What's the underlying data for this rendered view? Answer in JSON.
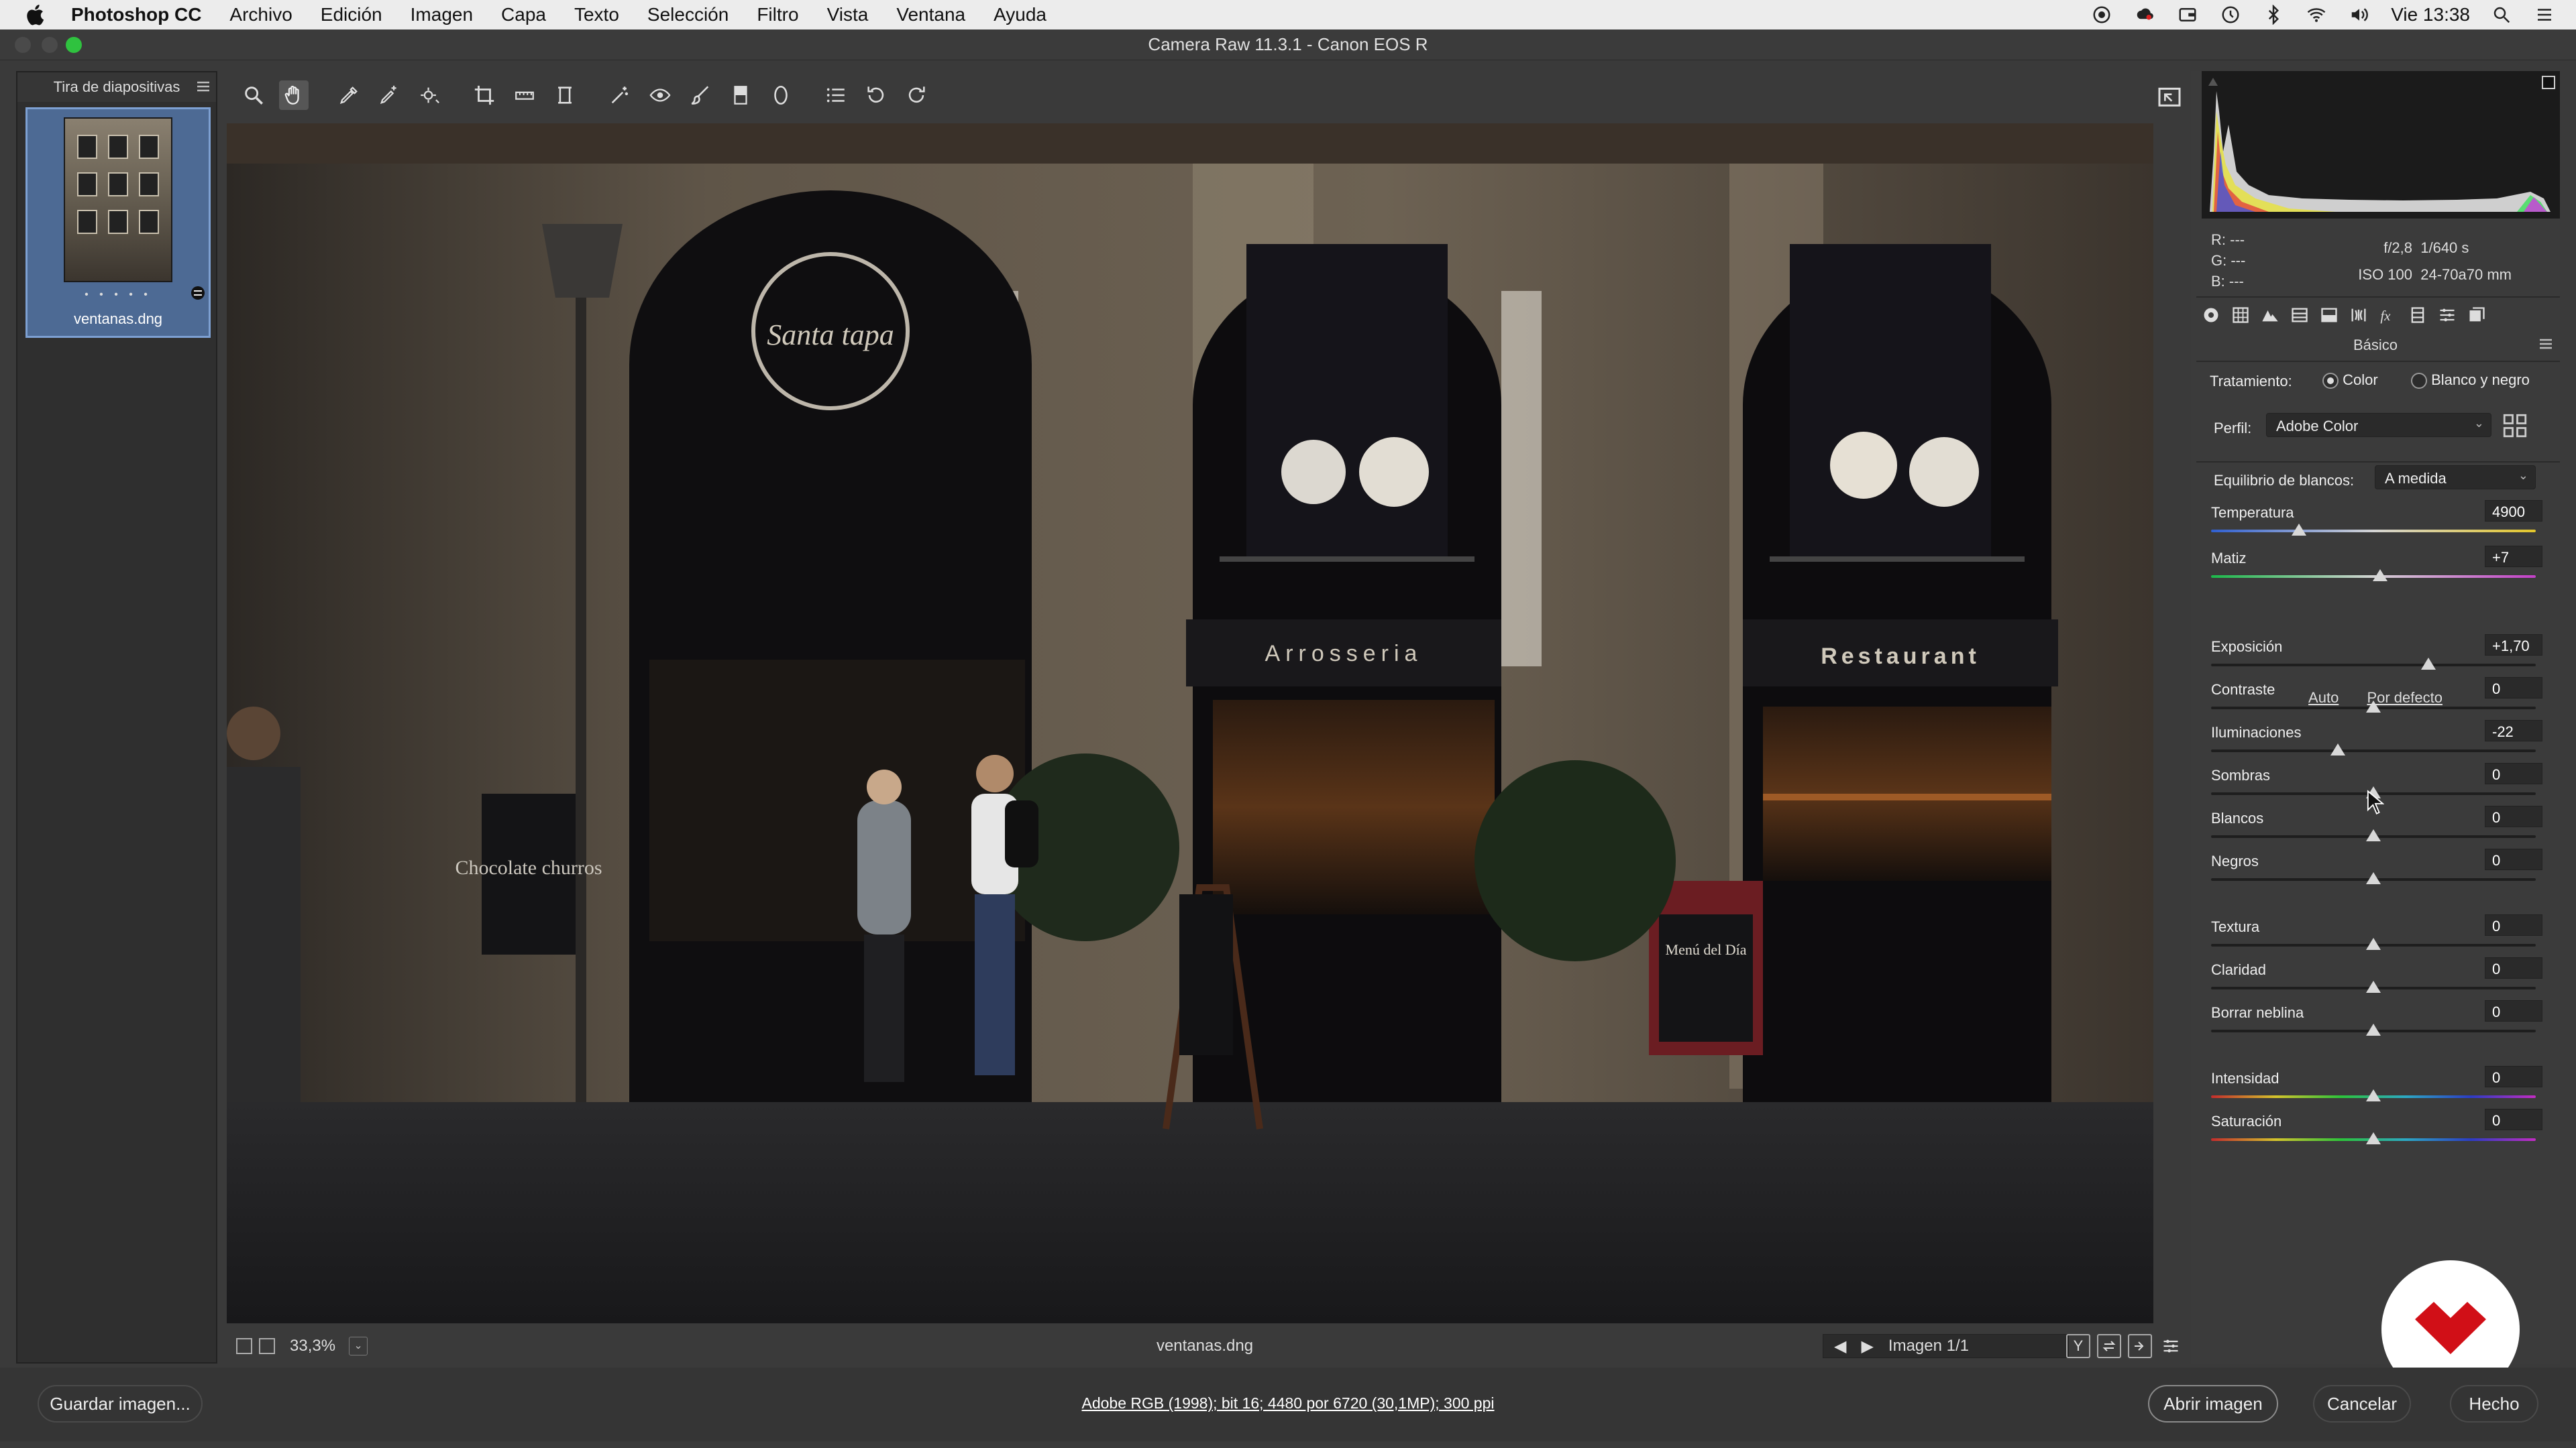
{
  "menubar": {
    "items": [
      "Photoshop CC",
      "Archivo",
      "Edición",
      "Imagen",
      "Capa",
      "Texto",
      "Selección",
      "Filtro",
      "Vista",
      "Ventana",
      "Ayuda"
    ],
    "clock": "Vie 13:38"
  },
  "window": {
    "title": "Camera Raw 11.3.1 -  Canon EOS R"
  },
  "filmstrip": {
    "title": "Tira de diapositivas",
    "dots": "• • • • •",
    "filename": "ventanas.dng"
  },
  "photo": {
    "sign_santa": "Santa tapa",
    "sign_arrosseria": "Arrosseria",
    "sign_restaurant": "Restaurant",
    "chalk_left": "Chocolate churros",
    "chalk_right": "Menú del Día"
  },
  "status": {
    "zoom": "33,3%",
    "filename": "ventanas.dng",
    "image_counter": "Imagen 1/1",
    "view_y": "Y"
  },
  "readouts": {
    "r": "R:   ---",
    "g": "G:   ---",
    "b": "B:   ---",
    "aperture": "f/2,8",
    "shutter": "1/640 s",
    "iso": "ISO 100",
    "lens": "24-70a70 mm"
  },
  "panel": {
    "title": "Básico",
    "treatment_label": "Tratamiento:",
    "treatment_color": "Color",
    "treatment_bw": "Blanco y negro",
    "profile_label": "Perfil:",
    "profile_value": "Adobe Color",
    "wb_label": "Equilibrio de blancos:",
    "wb_value": "A medida",
    "auto": "Auto",
    "default": "Por defecto",
    "sliders": [
      {
        "label": "Temperatura",
        "value": "4900",
        "pos": 0.27
      },
      {
        "label": "Matiz",
        "value": "+7",
        "pos": 0.52
      },
      {
        "label": "Exposición",
        "value": "+1,70",
        "pos": 0.67
      },
      {
        "label": "Contraste",
        "value": "0",
        "pos": 0.5
      },
      {
        "label": "Iluminaciones",
        "value": "-22",
        "pos": 0.39
      },
      {
        "label": "Sombras",
        "value": "0",
        "pos": 0.5
      },
      {
        "label": "Blancos",
        "value": "0",
        "pos": 0.5
      },
      {
        "label": "Negros",
        "value": "0",
        "pos": 0.5
      },
      {
        "label": "Textura",
        "value": "0",
        "pos": 0.5
      },
      {
        "label": "Claridad",
        "value": "0",
        "pos": 0.5
      },
      {
        "label": "Borrar neblina",
        "value": "0",
        "pos": 0.5
      },
      {
        "label": "Intensidad",
        "value": "0",
        "pos": 0.5
      },
      {
        "label": "Saturación",
        "value": "0",
        "pos": 0.5
      }
    ]
  },
  "footer": {
    "save": "Guardar imagen...",
    "info": "Adobe RGB (1998); bit 16; 4480 por 6720 (30,1MP); 300 ppi",
    "open": "Abrir imagen",
    "cancel": "Cancelar",
    "done": "Hecho"
  },
  "colors": {
    "accent_green": "#2fc23f",
    "filmstrip_selected": "#4d6a94",
    "watermark_red": "#d10f17"
  }
}
